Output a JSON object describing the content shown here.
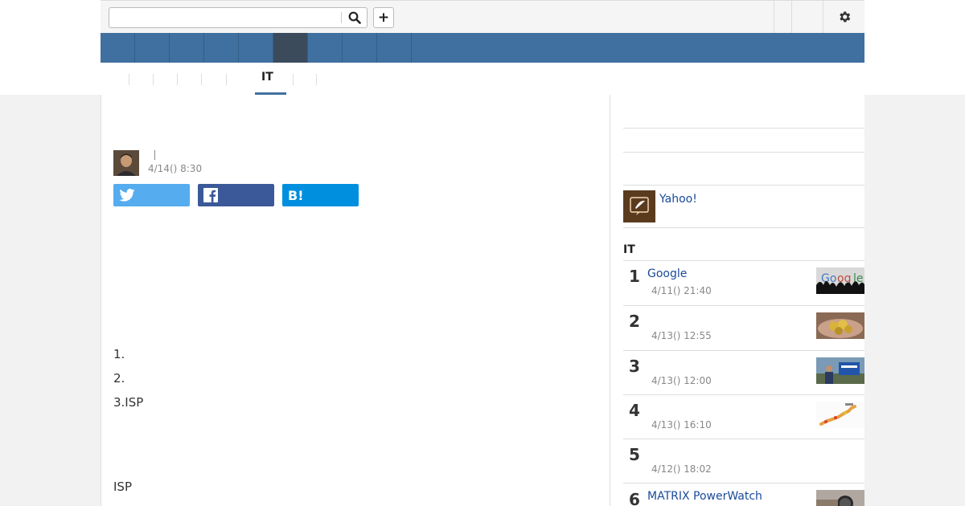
{
  "search": {
    "value": "",
    "placeholder": ""
  },
  "header": {
    "search_icon": "search-icon",
    "add_icon": "plus-icon",
    "plus_label": "+",
    "settings_icon": "gear-icon"
  },
  "nav": {
    "items": [
      "",
      "",
      "",
      "",
      "",
      "",
      "",
      "",
      ""
    ],
    "active_index": 4
  },
  "subnav": {
    "items": [
      "",
      "",
      "",
      "",
      "",
      "IT",
      ""
    ],
    "active_label": "IT"
  },
  "article": {
    "title": "",
    "author": "",
    "timestamp": "4/14() 8:30",
    "share": {
      "twitter": "",
      "facebook": "",
      "hatena": "B!"
    },
    "body": {
      "line1": "1.",
      "line2": "2.",
      "line3": "3.ISP",
      "para": "ISP"
    }
  },
  "sidebar": {
    "yahoo_link": "Yahoo!",
    "ranking_title": "IT",
    "ranking": [
      {
        "rank": "1",
        "title": "Google",
        "date": "4/11() 21:40"
      },
      {
        "rank": "2",
        "title": "",
        "date": "4/13() 12:55"
      },
      {
        "rank": "3",
        "title": "",
        "date": "4/13() 12:00"
      },
      {
        "rank": "4",
        "title": "",
        "date": "4/13() 16:10"
      },
      {
        "rank": "5",
        "title": "",
        "date": "4/12() 18:02"
      },
      {
        "rank": "6",
        "title": "MATRIX PowerWatch",
        "date": ""
      }
    ]
  },
  "colors": {
    "nav": "#40709f",
    "nav_active": "#3b4b5c",
    "link": "#1a4a9a",
    "twitter": "#55acee",
    "facebook": "#3b5998",
    "hatena": "#008fde"
  }
}
